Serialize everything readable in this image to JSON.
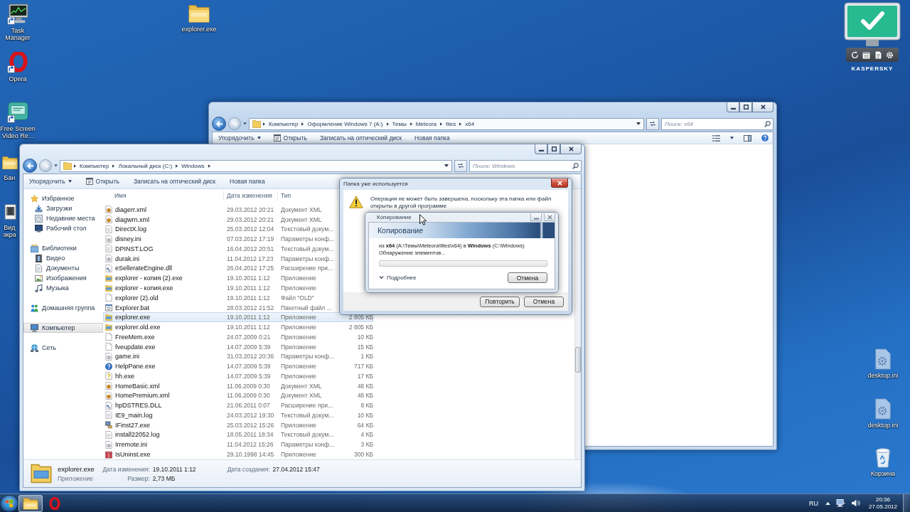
{
  "desktop": {
    "icons": [
      {
        "label": "Task Manager",
        "kind": "taskmgr"
      },
      {
        "label": "Opera",
        "kind": "opera"
      },
      {
        "label": "Free Screen Video Re...",
        "kind": "recorder"
      },
      {
        "label": "Бан",
        "kind": "folder"
      },
      {
        "label": "Вид экра",
        "kind": "video"
      },
      {
        "label": "explorer.exe",
        "kind": "folder"
      },
      {
        "label": "desktop.ini",
        "kind": "config"
      },
      {
        "label": "desktop.ini",
        "kind": "config"
      },
      {
        "label": "Корзина",
        "kind": "bin"
      }
    ]
  },
  "gadget": {
    "brand": "KASPERSKY"
  },
  "back_window": {
    "address": [
      "Компьютер",
      "Оформление Windows 7 (A:)",
      "Темы",
      "Meteora",
      "files",
      "x64"
    ],
    "trailing_chevron": false,
    "search_placeholder": "Поиск: x64",
    "toolbar": [
      {
        "label": "Упорядочить",
        "kind": "menu"
      },
      {
        "label": "Открыть",
        "kind": "open"
      },
      {
        "label": "Записать на оптический диск",
        "kind": "plain"
      },
      {
        "label": "Новая папка",
        "kind": "plain"
      }
    ]
  },
  "front_window": {
    "address": [
      "Компьютер",
      "Локальный диск (C:)",
      "Windows"
    ],
    "trailing_chevron": true,
    "search_placeholder": "Поиск: Windows",
    "toolbar": [
      {
        "label": "Упорядочить",
        "kind": "menu"
      },
      {
        "label": "Открыть",
        "kind": "open"
      },
      {
        "label": "Записать на оптический диск",
        "kind": "plain"
      },
      {
        "label": "Новая папка",
        "kind": "plain"
      }
    ],
    "navigation": [
      {
        "label": "Избранное",
        "kind": "favorites",
        "selected": false,
        "children": [
          {
            "label": "Загрузки",
            "kind": "downloads",
            "selected": false
          },
          {
            "label": "Недавние места",
            "kind": "recent",
            "selected": false
          },
          {
            "label": "Рабочий стол",
            "kind": "desktop",
            "selected": false
          }
        ]
      },
      {
        "label": "Библиотеки",
        "kind": "libraries",
        "selected": false,
        "children": [
          {
            "label": "Видео",
            "kind": "videos",
            "selected": false
          },
          {
            "label": "Документы",
            "kind": "documents",
            "selected": false
          },
          {
            "label": "Изображения",
            "kind": "pictures",
            "selected": false
          },
          {
            "label": "Музыка",
            "kind": "music",
            "selected": false
          }
        ]
      },
      {
        "label": "Домашняя группа",
        "kind": "homegroup",
        "selected": false
      },
      {
        "label": "Компьютер",
        "kind": "computer",
        "selected": true
      },
      {
        "label": "Сеть",
        "kind": "network",
        "selected": false
      }
    ],
    "files": {
      "columns": [
        "Имя",
        "Дата изменения",
        "Тип"
      ],
      "rows": [
        {
          "name": "diagerr.xml",
          "date": "29.03.2012 20:21",
          "type": "Документ XML",
          "kind": "xml",
          "selected": false
        },
        {
          "name": "diagwrn.xml",
          "date": "29.03.2012 20:21",
          "type": "Документ XML",
          "kind": "xml",
          "selected": false
        },
        {
          "name": "DirectX.log",
          "date": "25.03.2012 12:04",
          "type": "Текстовый докум...",
          "kind": "text",
          "selected": false
        },
        {
          "name": "disney.ini",
          "date": "07.03.2012 17:19",
          "type": "Параметры конф...",
          "kind": "config",
          "selected": false
        },
        {
          "name": "DPINST.LOG",
          "date": "16.04.2012 20:51",
          "type": "Текстовый докум...",
          "kind": "text",
          "selected": false
        },
        {
          "name": "durak.ini",
          "date": "11.04.2012 17:23",
          "type": "Параметры конф...",
          "kind": "config",
          "selected": false
        },
        {
          "name": "eSellerateEngine.dll",
          "date": "26.04.2012 17:25",
          "type": "Расширение при...",
          "kind": "library",
          "selected": false
        },
        {
          "name": "explorer - копия (2).exe",
          "date": "19.10.2011 1:12",
          "type": "Приложение",
          "kind": "explorer",
          "selected": false
        },
        {
          "name": "explorer - копия.exe",
          "date": "19.10.2011 1:12",
          "type": "Приложение",
          "kind": "explorer",
          "selected": false
        },
        {
          "name": "explorer (2).old",
          "date": "19.10.2011 1:12",
          "type": "Файл \"OLD\"",
          "kind": "blank",
          "selected": false
        },
        {
          "name": "Explorer.bat",
          "date": "28.03.2012 21:52",
          "type": "Пакетный файл ...",
          "kind": "batch",
          "selected": false
        },
        {
          "name": "explorer.exe",
          "date": "19.10.2011 1:12",
          "type": "Приложение",
          "size": "2 805 КБ",
          "kind": "explorer",
          "selected": true
        },
        {
          "name": "explorer.old.exe",
          "date": "19.10.2011 1:12",
          "type": "Приложение",
          "size": "2 805 КБ",
          "kind": "explorer",
          "selected": false
        },
        {
          "name": "FreeMem.exe",
          "date": "24.07.2009 0:21",
          "type": "Приложение",
          "size": "10 КБ",
          "kind": "blank",
          "selected": false
        },
        {
          "name": "fveupdate.exe",
          "date": "14.07.2009 5:39",
          "type": "Приложение",
          "size": "15 КБ",
          "kind": "blank",
          "selected": false
        },
        {
          "name": "game.ini",
          "date": "31.03.2012 20:36",
          "type": "Параметры конф...",
          "size": "1 КБ",
          "kind": "config",
          "selected": false
        },
        {
          "name": "HelpPane.exe",
          "date": "14.07.2009 5:39",
          "type": "Приложение",
          "size": "717 КБ",
          "kind": "help",
          "selected": false
        },
        {
          "name": "hh.exe",
          "date": "14.07.2009 5:39",
          "type": "Приложение",
          "size": "17 КБ",
          "kind": "helpfile",
          "selected": false
        },
        {
          "name": "HomeBasic.xml",
          "date": "11.06.2009 0:30",
          "type": "Документ XML",
          "size": "48 КБ",
          "kind": "xml",
          "selected": false
        },
        {
          "name": "HomePremium.xml",
          "date": "11.06.2009 0:30",
          "type": "Документ XML",
          "size": "48 КБ",
          "kind": "xml",
          "selected": false
        },
        {
          "name": "hpDSTRES.DLL",
          "date": "21.06.2011 0:07",
          "type": "Расширение при...",
          "size": "8 КБ",
          "kind": "library",
          "selected": false
        },
        {
          "name": "IE9_main.log",
          "date": "24.03.2012 19:30",
          "type": "Текстовый докум...",
          "size": "10 КБ",
          "kind": "text",
          "selected": false
        },
        {
          "name": "IFinst27.exe",
          "date": "25.03.2012 15:26",
          "type": "Приложение",
          "size": "64 КБ",
          "kind": "installer",
          "selected": false
        },
        {
          "name": "install22052.log",
          "date": "18.05.2011 18:34",
          "type": "Текстовый докум...",
          "size": "4 КБ",
          "kind": "text",
          "selected": false
        },
        {
          "name": "Irremote.ini",
          "date": "11.04.2012 15:26",
          "type": "Параметры конф...",
          "size": "3 КБ",
          "kind": "config",
          "selected": false
        },
        {
          "name": "IsUninst.exe",
          "date": "29.10.1998 14:45",
          "type": "Приложение",
          "size": "300 КБ",
          "kind": "uninstall",
          "selected": false
        }
      ]
    },
    "details": {
      "name": "explorer.exe",
      "type": "Приложение",
      "kind": "explorer",
      "fields": [
        {
          "label": "Дата изменения:",
          "value": "19.10.2011 1:12"
        },
        {
          "label": "Размер:",
          "value": "2,73 МБ"
        },
        {
          "label": "Дата создания:",
          "value": "27.04.2012 15:47"
        }
      ]
    }
  },
  "warning_dialog": {
    "title": "Папка уже используется",
    "message": "Операция не может быть завершена, поскольку эта папка или файл открыты в другой программе",
    "buttons": [
      "Повторить",
      "Отмена"
    ]
  },
  "copy_dialog": {
    "title": "Копирование",
    "heading": "Копирование",
    "source": "из **x64** (A:\\Темы\\Meteora\\files\\x64) в **Windows** (C:\\Windows)",
    "status": "Обнаружение элементов...",
    "progress": {
      "level": 0
    },
    "details_toggle": "Подробнее",
    "cancel": "Отмена"
  },
  "taskbar": {
    "buttons": [
      {
        "kind": "explorer",
        "selected": true
      },
      {
        "kind": "opera",
        "selected": false
      }
    ],
    "language": "RU",
    "time": "20:36",
    "date": "27.05.2012"
  }
}
